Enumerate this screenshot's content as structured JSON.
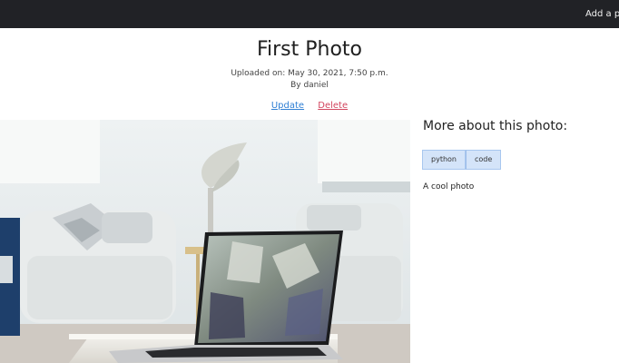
{
  "navbar": {
    "add_photo_link": "Add a photo"
  },
  "photo": {
    "title": "First Photo",
    "uploaded": "Uploaded on: May 30, 2021, 7:50 p.m.",
    "author": "By daniel",
    "actions": {
      "update": "Update",
      "delete": "Delete"
    }
  },
  "sidebar": {
    "heading": "More about this photo:",
    "tags": [
      "python",
      "code"
    ],
    "description": "A cool photo"
  }
}
